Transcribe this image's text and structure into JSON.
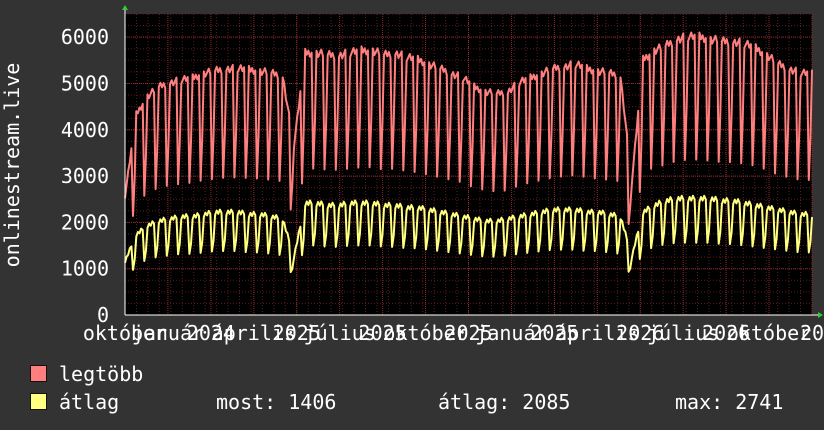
{
  "chart_data": {
    "type": "line",
    "ylabel": "onlinestream.live",
    "ylim": [
      0,
      6500
    ],
    "yticks": [
      0,
      1000,
      2000,
      3000,
      4000,
      5000,
      6000
    ],
    "grid": true,
    "legend_position": "bottom-left",
    "x_tick_labels": [
      "október",
      "január",
      "2024",
      "április",
      "2025",
      "július",
      "2025",
      "október",
      "2025",
      "január",
      "2025",
      "április",
      "2026",
      "július",
      "2026",
      "október",
      "20"
    ],
    "series": [
      {
        "name": "legtöbb",
        "color": "#ff7f7f",
        "values": [
          2600,
          4400,
          4800,
          5000,
          5100,
          5150,
          5200,
          5300,
          5350,
          5400,
          5400,
          5380,
          5350,
          5300,
          5250,
          3700,
          5750,
          5750,
          5700,
          5700,
          5750,
          5800,
          5800,
          5700,
          5750,
          5650,
          5600,
          5500,
          5400,
          5300,
          5200,
          5000,
          4900,
          4850,
          4900,
          5100,
          5200,
          5300,
          5400,
          5450,
          5500,
          5400,
          5350,
          5300,
          5250,
          2900,
          5600,
          5800,
          5900,
          6050,
          6100,
          6100,
          6050,
          6000,
          6000,
          5950,
          5850,
          5700,
          5500,
          5400,
          5300,
          5300
        ]
      },
      {
        "name": "átlag",
        "color": "#ffff80",
        "values": [
          1200,
          1800,
          2000,
          2100,
          2150,
          2200,
          2200,
          2250,
          2300,
          2300,
          2300,
          2250,
          2250,
          2200,
          2150,
          1300,
          2500,
          2500,
          2450,
          2450,
          2500,
          2500,
          2500,
          2450,
          2450,
          2400,
          2400,
          2350,
          2300,
          2250,
          2200,
          2150,
          2100,
          2100,
          2150,
          2200,
          2250,
          2300,
          2350,
          2350,
          2350,
          2300,
          2300,
          2250,
          2200,
          1300,
          2300,
          2450,
          2550,
          2600,
          2600,
          2600,
          2600,
          2550,
          2550,
          2500,
          2450,
          2400,
          2350,
          2300,
          2250,
          2250
        ]
      }
    ]
  },
  "legend": {
    "max_label": "legtöbb",
    "avg_label": "átlag",
    "stats": [
      {
        "label": "most:",
        "value": "1406"
      },
      {
        "label": "átlag:",
        "value": "2085"
      },
      {
        "label": "max:",
        "value": "2741"
      }
    ]
  }
}
